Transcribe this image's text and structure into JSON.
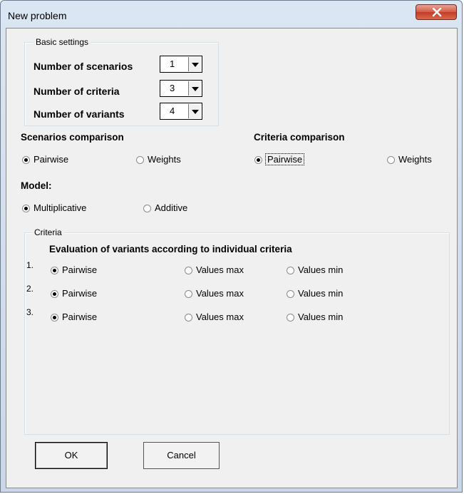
{
  "window": {
    "title": "New problem"
  },
  "basic_settings": {
    "legend": "Basic settings",
    "rows": [
      {
        "label": "Number of scenarios",
        "value": "1"
      },
      {
        "label": "Number of criteria",
        "value": "3"
      },
      {
        "label": "Number of variants",
        "value": "4"
      }
    ]
  },
  "scenarios_comparison": {
    "heading": "Scenarios comparison",
    "options": [
      {
        "label": "Pairwise",
        "checked": true
      },
      {
        "label": "Weights",
        "checked": false
      }
    ]
  },
  "criteria_comparison": {
    "heading": "Criteria comparison",
    "options": [
      {
        "label": "Pairwise",
        "checked": true
      },
      {
        "label": "Weights",
        "checked": false
      }
    ]
  },
  "model": {
    "heading": "Model:",
    "options": [
      {
        "label": "Multiplicative",
        "checked": true
      },
      {
        "label": "Additive",
        "checked": false
      }
    ]
  },
  "criteria": {
    "legend": "Criteria",
    "heading": "Evaluation of variants according to individual criteria",
    "rows": [
      {
        "number": "1.",
        "options": [
          "Pairwise",
          "Values max",
          "Values min"
        ],
        "selected": 0
      },
      {
        "number": "2.",
        "options": [
          "Pairwise",
          "Values max",
          "Values min"
        ],
        "selected": 0
      },
      {
        "number": "3.",
        "options": [
          "Pairwise",
          "Values max",
          "Values min"
        ],
        "selected": 0
      }
    ]
  },
  "buttons": {
    "ok": "OK",
    "cancel": "Cancel"
  }
}
